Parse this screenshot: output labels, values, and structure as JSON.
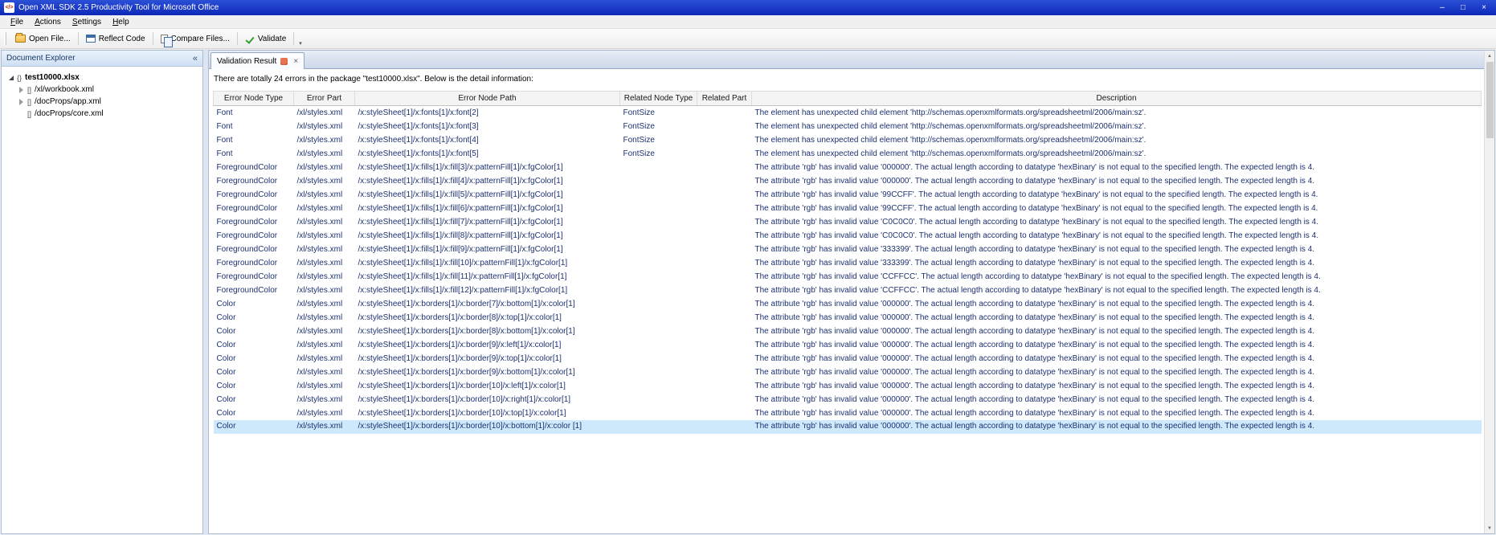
{
  "window": {
    "title": "Open XML SDK 2.5 Productivity Tool for Microsoft Office",
    "app_icon_glyph": "</>",
    "minimize_glyph": "–",
    "maximize_glyph": "□",
    "close_glyph": "×"
  },
  "menu": {
    "items": [
      {
        "label": "File"
      },
      {
        "label": "Actions"
      },
      {
        "label": "Settings"
      },
      {
        "label": "Help"
      }
    ]
  },
  "toolbar": {
    "buttons": [
      {
        "label": "Open File...",
        "icon": "open-file-icon"
      },
      {
        "label": "Reflect Code",
        "icon": "reflect-code-icon"
      },
      {
        "label": "Compare Files...",
        "icon": "compare-files-icon"
      },
      {
        "label": "Validate",
        "icon": "validate-icon"
      }
    ],
    "overflow_glyph": "▾"
  },
  "explorer": {
    "title": "Document Explorer",
    "collapse_button": "«",
    "tree": [
      {
        "icon": "{}",
        "label": "test10000.xlsx",
        "level": 0,
        "state": "expanded",
        "bold": true
      },
      {
        "icon": "[]",
        "label": "/xl/workbook.xml",
        "level": 1,
        "state": "collapsed",
        "bold": false
      },
      {
        "icon": "[]",
        "label": "/docProps/app.xml",
        "level": 1,
        "state": "collapsed",
        "bold": false
      },
      {
        "icon": "[]",
        "label": "/docProps/core.xml",
        "level": 1,
        "state": "none",
        "bold": false
      }
    ]
  },
  "main": {
    "tab": {
      "label": "Validation Result",
      "close": "×"
    },
    "summary": "There are totally 24 errors in the package \"test10000.xlsx\". Below is the detail information:",
    "table": {
      "columns": [
        "Error Node Type",
        "Error Part",
        "Error Node Path",
        "Related Node Type",
        "Related Part",
        "Description"
      ],
      "rows": [
        {
          "type": "Font",
          "part": "/xl/styles.xml",
          "path": "/x:styleSheet[1]/x:fonts[1]/x:font[2]",
          "related_type": "FontSize",
          "related_part": "",
          "desc": "The element has unexpected child element 'http://schemas.openxmlformats.org/spreadsheetml/2006/main:sz'."
        },
        {
          "type": "Font",
          "part": "/xl/styles.xml",
          "path": "/x:styleSheet[1]/x:fonts[1]/x:font[3]",
          "related_type": "FontSize",
          "related_part": "",
          "desc": "The element has unexpected child element 'http://schemas.openxmlformats.org/spreadsheetml/2006/main:sz'."
        },
        {
          "type": "Font",
          "part": "/xl/styles.xml",
          "path": "/x:styleSheet[1]/x:fonts[1]/x:font[4]",
          "related_type": "FontSize",
          "related_part": "",
          "desc": "The element has unexpected child element 'http://schemas.openxmlformats.org/spreadsheetml/2006/main:sz'."
        },
        {
          "type": "Font",
          "part": "/xl/styles.xml",
          "path": "/x:styleSheet[1]/x:fonts[1]/x:font[5]",
          "related_type": "FontSize",
          "related_part": "",
          "desc": "The element has unexpected child element 'http://schemas.openxmlformats.org/spreadsheetml/2006/main:sz'."
        },
        {
          "type": "ForegroundColor",
          "part": "/xl/styles.xml",
          "path": "/x:styleSheet[1]/x:fills[1]/x:fill[3]/x:patternFill[1]/x:fgColor[1]",
          "related_type": "",
          "related_part": "",
          "desc": "The attribute 'rgb' has invalid value '000000'. The actual length according to datatype 'hexBinary' is not equal to the specified length. The expected length is 4."
        },
        {
          "type": "ForegroundColor",
          "part": "/xl/styles.xml",
          "path": "/x:styleSheet[1]/x:fills[1]/x:fill[4]/x:patternFill[1]/x:fgColor[1]",
          "related_type": "",
          "related_part": "",
          "desc": "The attribute 'rgb' has invalid value '000000'. The actual length according to datatype 'hexBinary' is not equal to the specified length. The expected length is 4."
        },
        {
          "type": "ForegroundColor",
          "part": "/xl/styles.xml",
          "path": "/x:styleSheet[1]/x:fills[1]/x:fill[5]/x:patternFill[1]/x:fgColor[1]",
          "related_type": "",
          "related_part": "",
          "desc": "The attribute 'rgb' has invalid value '99CCFF'. The actual length according to datatype 'hexBinary' is not equal to the specified length. The expected length is 4."
        },
        {
          "type": "ForegroundColor",
          "part": "/xl/styles.xml",
          "path": "/x:styleSheet[1]/x:fills[1]/x:fill[6]/x:patternFill[1]/x:fgColor[1]",
          "related_type": "",
          "related_part": "",
          "desc": "The attribute 'rgb' has invalid value '99CCFF'. The actual length according to datatype 'hexBinary' is not equal to the specified length. The expected length is 4."
        },
        {
          "type": "ForegroundColor",
          "part": "/xl/styles.xml",
          "path": "/x:styleSheet[1]/x:fills[1]/x:fill[7]/x:patternFill[1]/x:fgColor[1]",
          "related_type": "",
          "related_part": "",
          "desc": "The attribute 'rgb' has invalid value 'C0C0C0'. The actual length according to datatype 'hexBinary' is not equal to the specified length. The expected length is 4."
        },
        {
          "type": "ForegroundColor",
          "part": "/xl/styles.xml",
          "path": "/x:styleSheet[1]/x:fills[1]/x:fill[8]/x:patternFill[1]/x:fgColor[1]",
          "related_type": "",
          "related_part": "",
          "desc": "The attribute 'rgb' has invalid value 'C0C0C0'. The actual length according to datatype 'hexBinary' is not equal to the specified length. The expected length is 4."
        },
        {
          "type": "ForegroundColor",
          "part": "/xl/styles.xml",
          "path": "/x:styleSheet[1]/x:fills[1]/x:fill[9]/x:patternFill[1]/x:fgColor[1]",
          "related_type": "",
          "related_part": "",
          "desc": "The attribute 'rgb' has invalid value '333399'. The actual length according to datatype 'hexBinary' is not equal to the specified length. The expected length is 4."
        },
        {
          "type": "ForegroundColor",
          "part": "/xl/styles.xml",
          "path": "/x:styleSheet[1]/x:fills[1]/x:fill[10]/x:patternFill[1]/x:fgColor[1]",
          "related_type": "",
          "related_part": "",
          "desc": "The attribute 'rgb' has invalid value '333399'. The actual length according to datatype 'hexBinary' is not equal to the specified length. The expected length is 4."
        },
        {
          "type": "ForegroundColor",
          "part": "/xl/styles.xml",
          "path": "/x:styleSheet[1]/x:fills[1]/x:fill[11]/x:patternFill[1]/x:fgColor[1]",
          "related_type": "",
          "related_part": "",
          "desc": "The attribute 'rgb' has invalid value 'CCFFCC'. The actual length according to datatype 'hexBinary' is not equal to the specified length. The expected length is 4."
        },
        {
          "type": "ForegroundColor",
          "part": "/xl/styles.xml",
          "path": "/x:styleSheet[1]/x:fills[1]/x:fill[12]/x:patternFill[1]/x:fgColor[1]",
          "related_type": "",
          "related_part": "",
          "desc": "The attribute 'rgb' has invalid value 'CCFFCC'. The actual length according to datatype 'hexBinary' is not equal to the specified length. The expected length is 4."
        },
        {
          "type": "Color",
          "part": "/xl/styles.xml",
          "path": "/x:styleSheet[1]/x:borders[1]/x:border[7]/x:bottom[1]/x:color[1]",
          "related_type": "",
          "related_part": "",
          "desc": "The attribute 'rgb' has invalid value '000000'. The actual length according to datatype 'hexBinary' is not equal to the specified length. The expected length is 4."
        },
        {
          "type": "Color",
          "part": "/xl/styles.xml",
          "path": "/x:styleSheet[1]/x:borders[1]/x:border[8]/x:top[1]/x:color[1]",
          "related_type": "",
          "related_part": "",
          "desc": "The attribute 'rgb' has invalid value '000000'. The actual length according to datatype 'hexBinary' is not equal to the specified length. The expected length is 4."
        },
        {
          "type": "Color",
          "part": "/xl/styles.xml",
          "path": "/x:styleSheet[1]/x:borders[1]/x:border[8]/x:bottom[1]/x:color[1]",
          "related_type": "",
          "related_part": "",
          "desc": "The attribute 'rgb' has invalid value '000000'. The actual length according to datatype 'hexBinary' is not equal to the specified length. The expected length is 4."
        },
        {
          "type": "Color",
          "part": "/xl/styles.xml",
          "path": "/x:styleSheet[1]/x:borders[1]/x:border[9]/x:left[1]/x:color[1]",
          "related_type": "",
          "related_part": "",
          "desc": "The attribute 'rgb' has invalid value '000000'. The actual length according to datatype 'hexBinary' is not equal to the specified length. The expected length is 4."
        },
        {
          "type": "Color",
          "part": "/xl/styles.xml",
          "path": "/x:styleSheet[1]/x:borders[1]/x:border[9]/x:top[1]/x:color[1]",
          "related_type": "",
          "related_part": "",
          "desc": "The attribute 'rgb' has invalid value '000000'. The actual length according to datatype 'hexBinary' is not equal to the specified length. The expected length is 4."
        },
        {
          "type": "Color",
          "part": "/xl/styles.xml",
          "path": "/x:styleSheet[1]/x:borders[1]/x:border[9]/x:bottom[1]/x:color[1]",
          "related_type": "",
          "related_part": "",
          "desc": "The attribute 'rgb' has invalid value '000000'. The actual length according to datatype 'hexBinary' is not equal to the specified length. The expected length is 4."
        },
        {
          "type": "Color",
          "part": "/xl/styles.xml",
          "path": "/x:styleSheet[1]/x:borders[1]/x:border[10]/x:left[1]/x:color[1]",
          "related_type": "",
          "related_part": "",
          "desc": "The attribute 'rgb' has invalid value '000000'. The actual length according to datatype 'hexBinary' is not equal to the specified length. The expected length is 4."
        },
        {
          "type": "Color",
          "part": "/xl/styles.xml",
          "path": "/x:styleSheet[1]/x:borders[1]/x:border[10]/x:right[1]/x:color[1]",
          "related_type": "",
          "related_part": "",
          "desc": "The attribute 'rgb' has invalid value '000000'. The actual length according to datatype 'hexBinary' is not equal to the specified length. The expected length is 4."
        },
        {
          "type": "Color",
          "part": "/xl/styles.xml",
          "path": "/x:styleSheet[1]/x:borders[1]/x:border[10]/x:top[1]/x:color[1]",
          "related_type": "",
          "related_part": "",
          "desc": "The attribute 'rgb' has invalid value '000000'. The actual length according to datatype 'hexBinary' is not equal to the specified length. The expected length is 4."
        },
        {
          "type": "Color",
          "part": "/xl/styles.xml",
          "path": "/x:styleSheet[1]/x:borders[1]/x:border[10]/x:bottom[1]/x:color[1]",
          "related_type": "",
          "related_part": "",
          "desc": "The attribute 'rgb' has invalid value '000000'. The actual length according to datatype 'hexBinary' is not equal to the specified length. The expected length is 4.",
          "selected": true
        }
      ]
    }
  },
  "scrollbar": {
    "up_glyph": "▲",
    "down_glyph": "▼"
  },
  "colors": {
    "titlebar": "#1a34cc",
    "selection": "#cfe9fc",
    "grid_text": "#1d3170",
    "panel_header": "#cfe0f3"
  }
}
